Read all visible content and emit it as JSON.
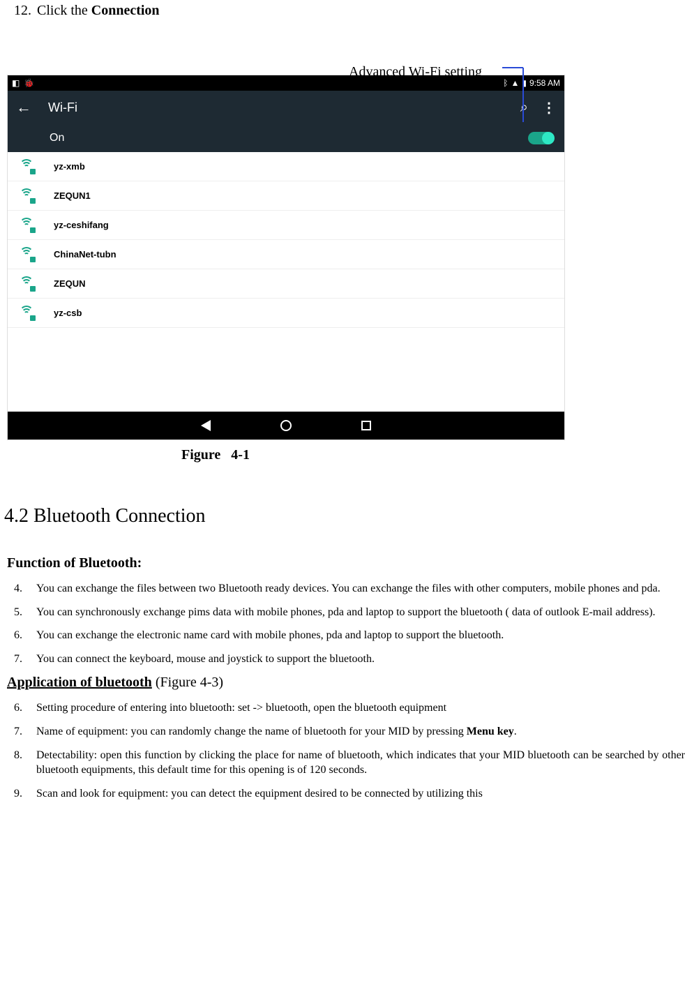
{
  "step": {
    "num": "12.",
    "pre": "Click the ",
    "bold": "Connection"
  },
  "callout": "Advanced Wi-Fi setting",
  "statusbar": {
    "time": "9:58 AM"
  },
  "wifibar": {
    "back": "←",
    "title": "Wi-Fi",
    "search": "⌕",
    "menu": "⋮"
  },
  "onrow": {
    "label": "On"
  },
  "networks": [
    {
      "name": "yz-xmb"
    },
    {
      "name": "ZEQUN1"
    },
    {
      "name": "yz-ceshifang"
    },
    {
      "name": "ChinaNet-tubn"
    },
    {
      "name": "ZEQUN"
    },
    {
      "name": "yz-csb"
    }
  ],
  "figure_caption_a": "Figure",
  "figure_caption_b": "4-1",
  "section_heading": "4.2 Bluetooth Connection",
  "func_heading": "Function of Bluetooth:",
  "func_list": [
    {
      "num": "4.",
      "text": "You can exchange the files between two Bluetooth ready devices. You can exchange    the files with other computers, mobile phones and pda."
    },
    {
      "num": "5.",
      "text": "You can synchronously exchange pims data with mobile phones, pda and laptop to support the bluetooth ( data of outlook E-mail address)."
    },
    {
      "num": "6.",
      "text": "You can exchange the electronic name card with mobile phones, pda and laptop to support the bluetooth."
    },
    {
      "num": "7.",
      "text": "You can connect the keyboard, mouse and joystick to support the bluetooth."
    }
  ],
  "app_heading_pre": "Application of bluetooth",
  "app_heading_post": " (Figure 4-3)",
  "app_list": [
    {
      "num": "6.",
      "pre": "Setting procedure of entering into bluetooth: set -> bluetooth, open the bluetooth equipment",
      "bold": "",
      "post": ""
    },
    {
      "num": "7.",
      "pre": "Name of equipment: you can randomly change the name of bluetooth for your MID by pressing ",
      "bold": "Menu key",
      "post": "."
    },
    {
      "num": "8.",
      "pre": "Detectability: open this function by clicking the place for name of bluetooth, which indicates that your MID bluetooth can be searched by other bluetooth equipments, this default time for this opening is of 120 seconds.",
      "bold": "",
      "post": ""
    },
    {
      "num": "9.",
      "pre": "Scan and look for equipment: you can detect the equipment desired to be connected by utilizing this",
      "bold": "",
      "post": ""
    }
  ]
}
